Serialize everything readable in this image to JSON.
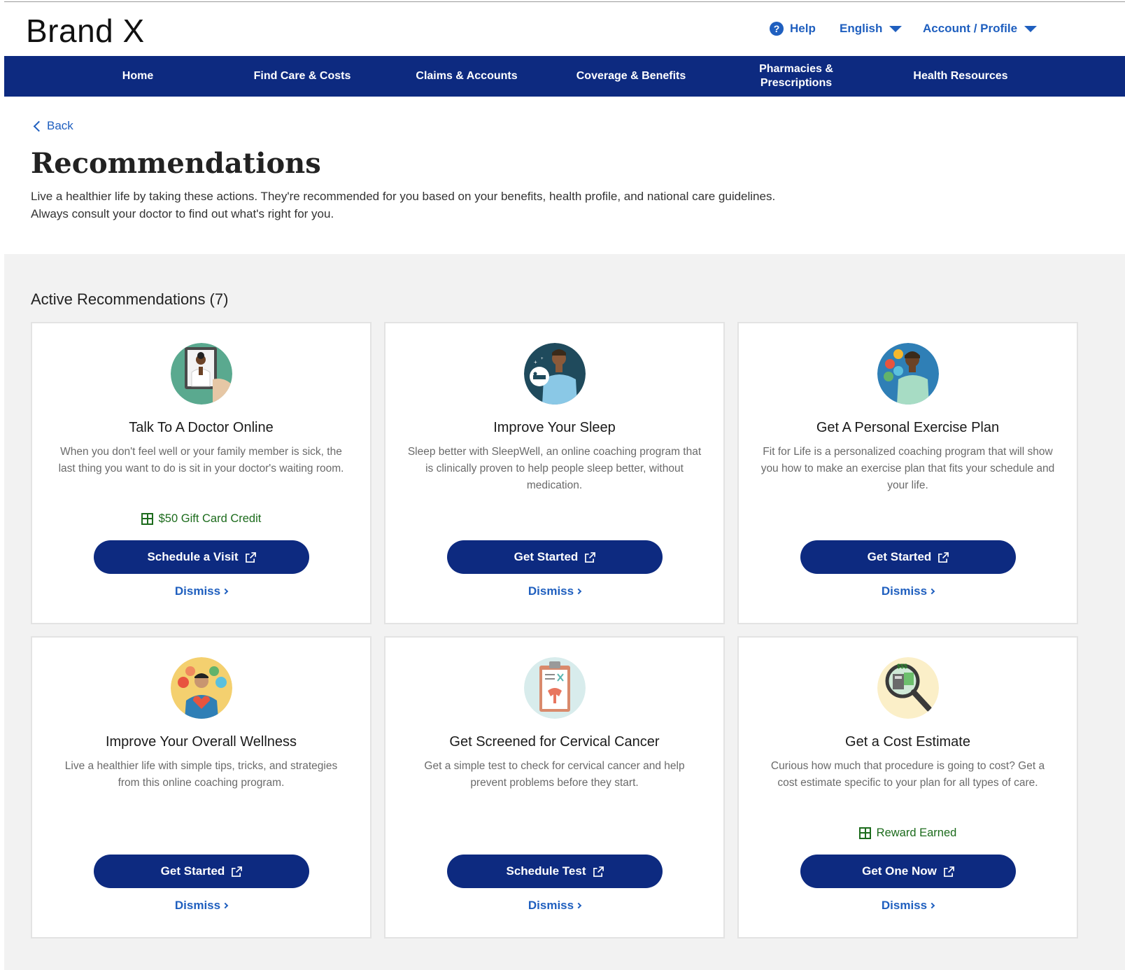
{
  "header": {
    "brand": "Brand X",
    "help_label": "Help",
    "language_label": "English",
    "account_label": "Account / Profile"
  },
  "nav": {
    "items": [
      {
        "label": "Home"
      },
      {
        "label": "Find Care & Costs"
      },
      {
        "label": "Claims & Accounts"
      },
      {
        "label": "Coverage & Benefits"
      },
      {
        "label": "Pharmacies & Prescriptions"
      },
      {
        "label": "Health Resources"
      }
    ]
  },
  "intro": {
    "back_label": "Back",
    "title": "Recommendations",
    "line1": "Live a healthier life by taking these actions. They're recommended for you based on your benefits, health profile, and national care guidelines.",
    "line2": "Always consult your doctor to find out what's right for you."
  },
  "section": {
    "title": "Active Recommendations (7)"
  },
  "cards": [
    {
      "icon": "doctor-tablet-icon",
      "title": "Talk To A Doctor Online",
      "desc": "When you don't feel well or your family member is sick, the last thing you want to do is sit in your doctor's waiting room.",
      "reward": "$50 Gift Card Credit",
      "cta": "Schedule a Visit",
      "dismiss": "Dismiss"
    },
    {
      "icon": "sleep-coach-icon",
      "title": "Improve Your Sleep",
      "desc": "Sleep better with SleepWell, an online coaching program that is clinically proven to help people sleep better, without medication.",
      "reward": "",
      "cta": "Get Started",
      "dismiss": "Dismiss"
    },
    {
      "icon": "exercise-plan-icon",
      "title": "Get A Personal Exercise Plan",
      "desc": "Fit for Life is a personalized coaching program that will show you how to make an exercise plan that fits your schedule and your life.",
      "reward": "",
      "cta": "Get Started",
      "dismiss": "Dismiss"
    },
    {
      "icon": "wellness-heart-icon",
      "title": "Improve Your Overall Wellness",
      "desc": "Live a healthier life with simple tips, tricks, and strategies from this online coaching program.",
      "reward": "",
      "cta": "Get Started",
      "dismiss": "Dismiss"
    },
    {
      "icon": "clipboard-screening-icon",
      "title": "Get Screened for Cervical Cancer",
      "desc": "Get a simple test to check for cervical cancer and help prevent problems before they start.",
      "reward": "",
      "cta": "Schedule Test",
      "dismiss": "Dismiss"
    },
    {
      "icon": "cost-magnifier-icon",
      "title": "Get a Cost Estimate",
      "desc": "Curious how much that procedure is going to cost? Get a cost estimate specific to your plan for all types of care.",
      "reward": "Reward Earned",
      "cta": "Get One Now",
      "dismiss": "Dismiss"
    }
  ],
  "colors": {
    "nav_bg": "#0d2a80",
    "link": "#1f5fbf",
    "reward": "#1c6b1c",
    "page_bg": "#f2f2f2"
  }
}
